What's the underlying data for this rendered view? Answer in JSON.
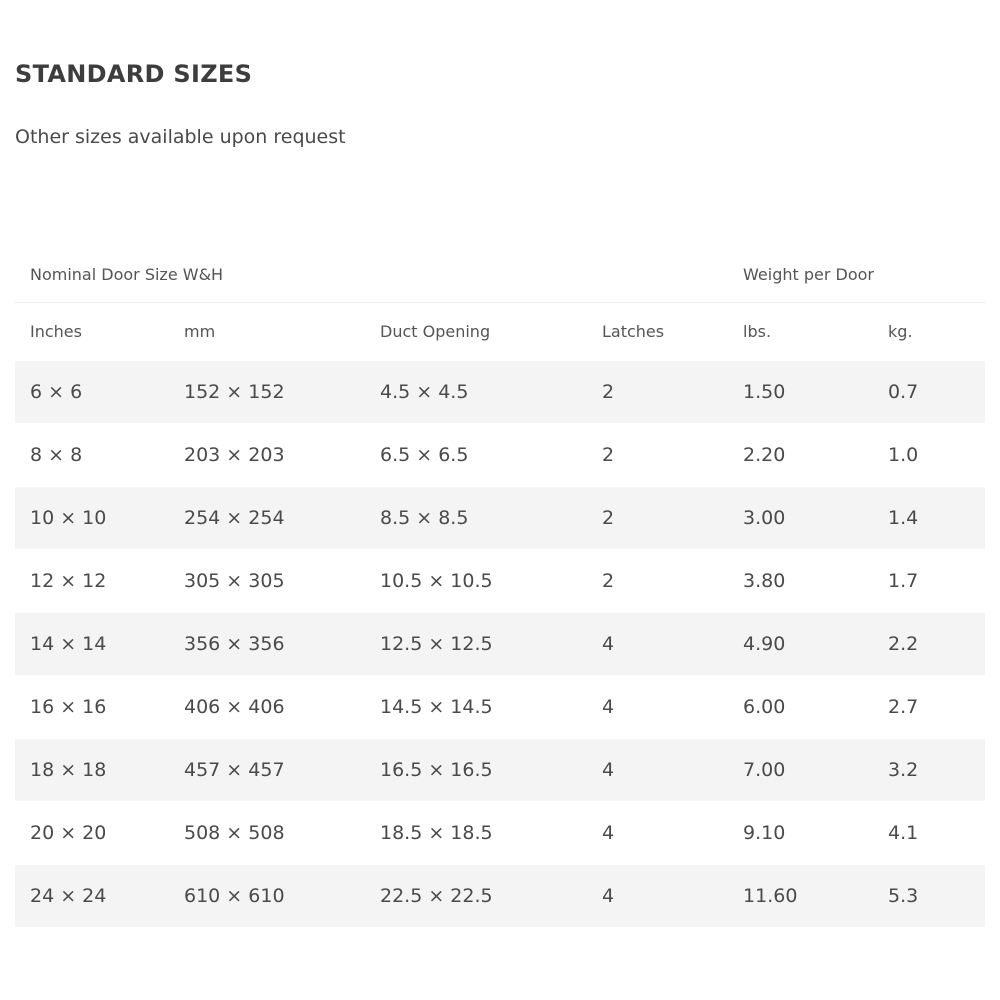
{
  "header": {
    "title": "STANDARD SIZES",
    "subtitle": "Other sizes available upon request"
  },
  "table": {
    "group_headers": {
      "nominal": "Nominal Door Size W&H",
      "weight": "Weight per Door"
    },
    "columns": [
      "Inches",
      "mm",
      "Duct Opening",
      "Latches",
      "lbs.",
      "kg."
    ],
    "rows": [
      [
        "6 × 6",
        "152 × 152",
        "4.5 × 4.5",
        "2",
        "1.50",
        "0.7"
      ],
      [
        "8 × 8",
        "203 × 203",
        "6.5 × 6.5",
        "2",
        "2.20",
        "1.0"
      ],
      [
        "10 × 10",
        "254 × 254",
        "8.5 × 8.5",
        "2",
        "3.00",
        "1.4"
      ],
      [
        "12 × 12",
        "305 × 305",
        "10.5 × 10.5",
        "2",
        "3.80",
        "1.7"
      ],
      [
        "14 × 14",
        "356 × 356",
        "12.5 × 12.5",
        "4",
        "4.90",
        "2.2"
      ],
      [
        "16 × 16",
        "406 × 406",
        "14.5 × 14.5",
        "4",
        "6.00",
        "2.7"
      ],
      [
        "18 × 18",
        "457 × 457",
        "16.5 × 16.5",
        "4",
        "7.00",
        "3.2"
      ],
      [
        "20 × 20",
        "508 × 508",
        "18.5 × 18.5",
        "4",
        "9.10",
        "4.1"
      ],
      [
        "24 × 24",
        "610 × 610",
        "22.5 × 22.5",
        "4",
        "11.60",
        "5.3"
      ]
    ]
  }
}
